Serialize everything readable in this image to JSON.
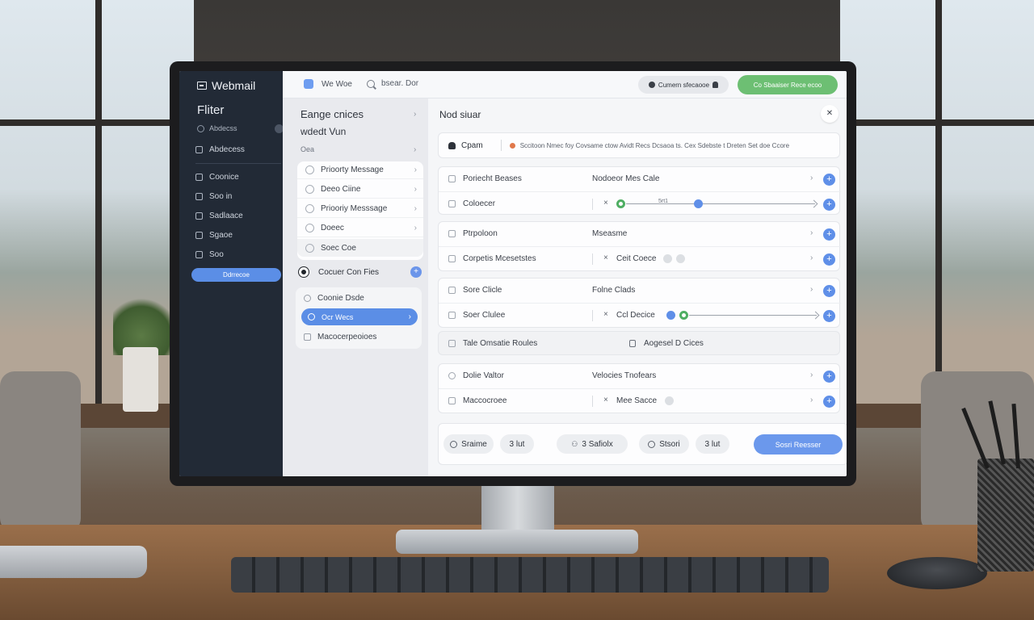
{
  "app": {
    "name": "Webmail"
  },
  "sidebar": {
    "title": "Fliter",
    "sub": "Abdecss",
    "top_item": "Abdecess",
    "items": [
      {
        "label": "Coonice",
        "icon": "compass-icon"
      },
      {
        "label": "Soo in",
        "icon": "inbox-icon"
      },
      {
        "label": "Sadlaace",
        "icon": "list-icon"
      },
      {
        "label": "Sgaoe",
        "icon": "trash-icon"
      },
      {
        "label": "Soo",
        "icon": "doc-icon"
      }
    ],
    "button": "Ddrrecoe"
  },
  "topbar": {
    "app_label": "We Woe",
    "search_text": "bsear.  Dor",
    "pill_label": "Cumern sfecaooe",
    "green_label": "Co Sbaaiser Rece ecoo"
  },
  "middle": {
    "heading": "Eange cnices",
    "subheading": "wdedt Vun",
    "small": "Oea",
    "list": [
      "Prioorty Message",
      "Deeo Ciine",
      "Priooriy Messsage",
      "Doeec",
      "Soec Coe"
    ],
    "selected": "Cocuer Con Fies",
    "group": [
      "Coonie Dsde",
      "Ocr Wecs",
      "Macocerpeoioes"
    ]
  },
  "main": {
    "title": "Nod siuar",
    "filter": {
      "label": "Cpam",
      "desc": "Sccitoon Nmec foy Covsame ctow Avidt Recs Dcsaoa ts. Cex Sdebste t Dreten Set doe Ccore"
    },
    "rows": [
      {
        "label": "Poriecht Beases",
        "value": "Nodoeor Mes Cale"
      },
      {
        "label": "Coloecer",
        "value": "",
        "slider_tag": "5rt1"
      },
      {
        "label": "Ptrpoloon",
        "value": "Mseasme"
      },
      {
        "label": "Corpetis Mcesetstes",
        "value": "Ceit Coece"
      },
      {
        "label": "Sore Clicle",
        "value": "Folne Clads"
      },
      {
        "label": "Soer Clulee",
        "value": "Ccl Decice"
      },
      {
        "label": "Tale Omsatie Roules",
        "value": "Aogesel  D Cices"
      },
      {
        "label": "Dolie Valtor",
        "value": "Velocies Tnofears"
      },
      {
        "label": "Maccocroee",
        "value": "Mee Sacce"
      }
    ],
    "buttons": [
      "Sraime",
      "3 lut",
      "3 Safiolx",
      "Stsori",
      "3 lut"
    ],
    "primary": "Sosri Reesser"
  }
}
